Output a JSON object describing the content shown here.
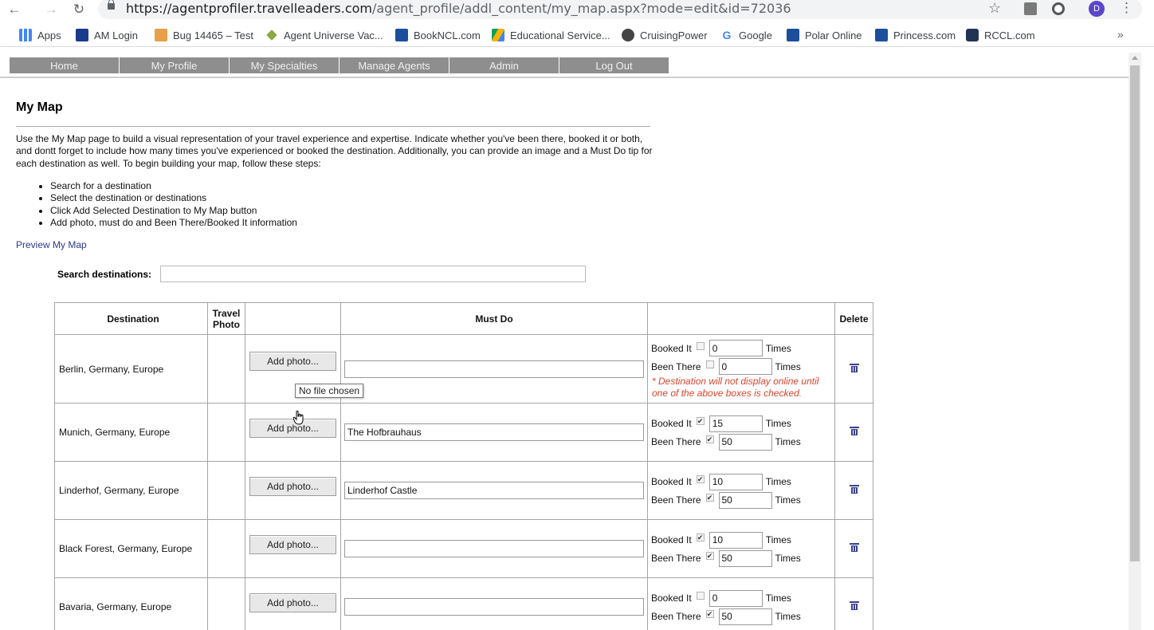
{
  "browser": {
    "url_host": "https://agentprofiler.travelleaders.com",
    "url_path": "/agent_profile/addl_content/my_map.aspx?mode=edit&id=72036",
    "profile_initial": "D",
    "bookmarks": [
      {
        "label": "Apps",
        "icon": "apps-grid-icon",
        "color": "#4285f4"
      },
      {
        "label": "AM Login",
        "icon": "am-login-icon",
        "color": "#1a3a8a"
      },
      {
        "label": "Bug 14465 – Test",
        "icon": "bug-icon",
        "color": "#e8a04a"
      },
      {
        "label": "Agent Universe Vac...",
        "icon": "agent-universe-icon",
        "color": "#8fa83e"
      },
      {
        "label": "BookNCL.com",
        "icon": "ncl-icon",
        "color": "#1b4f9c"
      },
      {
        "label": "Educational Service...",
        "icon": "drive-icon",
        "color": "#f4b400"
      },
      {
        "label": "CruisingPower",
        "icon": "cruisingpower-icon",
        "color": "#444444"
      },
      {
        "label": "Google",
        "icon": "google-icon",
        "color": "#4285f4"
      },
      {
        "label": "Polar Online",
        "icon": "polar-icon",
        "color": "#1b4f9c"
      },
      {
        "label": "Princess.com",
        "icon": "princess-icon",
        "color": "#1b4f9c"
      },
      {
        "label": "RCCL.com",
        "icon": "rccl-icon",
        "color": "#223355"
      }
    ],
    "more": "»"
  },
  "nav": {
    "tabs": [
      "Home",
      "My Profile",
      "My Specialties",
      "Manage Agents",
      "Admin",
      "Log Out"
    ]
  },
  "page": {
    "title": "My Map",
    "intro": "Use the My Map page to build a visual representation of your travel experience and expertise. Indicate whether you've been there, booked it or both, and dontt forget to include how many times you've experienced or booked the destination. Additionally, you can provide an image and a Must Do tip for each destination as well. To begin building your map, follow these steps:",
    "steps": [
      "Search for a destination",
      "Select the destination or destinations",
      "Click Add Selected Destination to My Map button",
      "Add photo, must do and Been There/Booked It information"
    ],
    "preview_link": "Preview My Map",
    "search_label": "Search destinations:",
    "search_value": ""
  },
  "table": {
    "headers": {
      "destination": "Destination",
      "travel_photo": "Travel Photo",
      "must_do": "Must Do",
      "delete": "Delete"
    },
    "add_photo_label": "Add photo...",
    "booked_label": "Booked It",
    "been_label": "Been There",
    "times_label": "Times",
    "warning": "* Destination will not display online until one of the above boxes is checked.",
    "rows": [
      {
        "destination": "Berlin, Germany, Europe",
        "must_do": "",
        "booked_checked": false,
        "booked_times": "0",
        "been_checked": false,
        "been_times": "0",
        "warning": true
      },
      {
        "destination": "Munich, Germany, Europe",
        "must_do": "The Hofbrauhaus",
        "booked_checked": true,
        "booked_times": "15",
        "been_checked": true,
        "been_times": "50",
        "warning": false
      },
      {
        "destination": "Linderhof, Germany, Europe",
        "must_do": "Linderhof Castle",
        "booked_checked": true,
        "booked_times": "10",
        "been_checked": true,
        "been_times": "50",
        "warning": false
      },
      {
        "destination": "Black Forest, Germany, Europe",
        "must_do": "",
        "booked_checked": true,
        "booked_times": "10",
        "been_checked": true,
        "been_times": "50",
        "warning": false
      },
      {
        "destination": "Bavaria, Germany, Europe",
        "must_do": "",
        "booked_checked": false,
        "booked_times": "0",
        "been_checked": true,
        "been_times": "50",
        "warning": false
      }
    ]
  },
  "tooltip": "No file chosen",
  "colors": {
    "nav_tab": "#8e8e8e",
    "link": "#2b3a8a",
    "warning": "#d9452b",
    "trash": "#3a3f8f"
  }
}
